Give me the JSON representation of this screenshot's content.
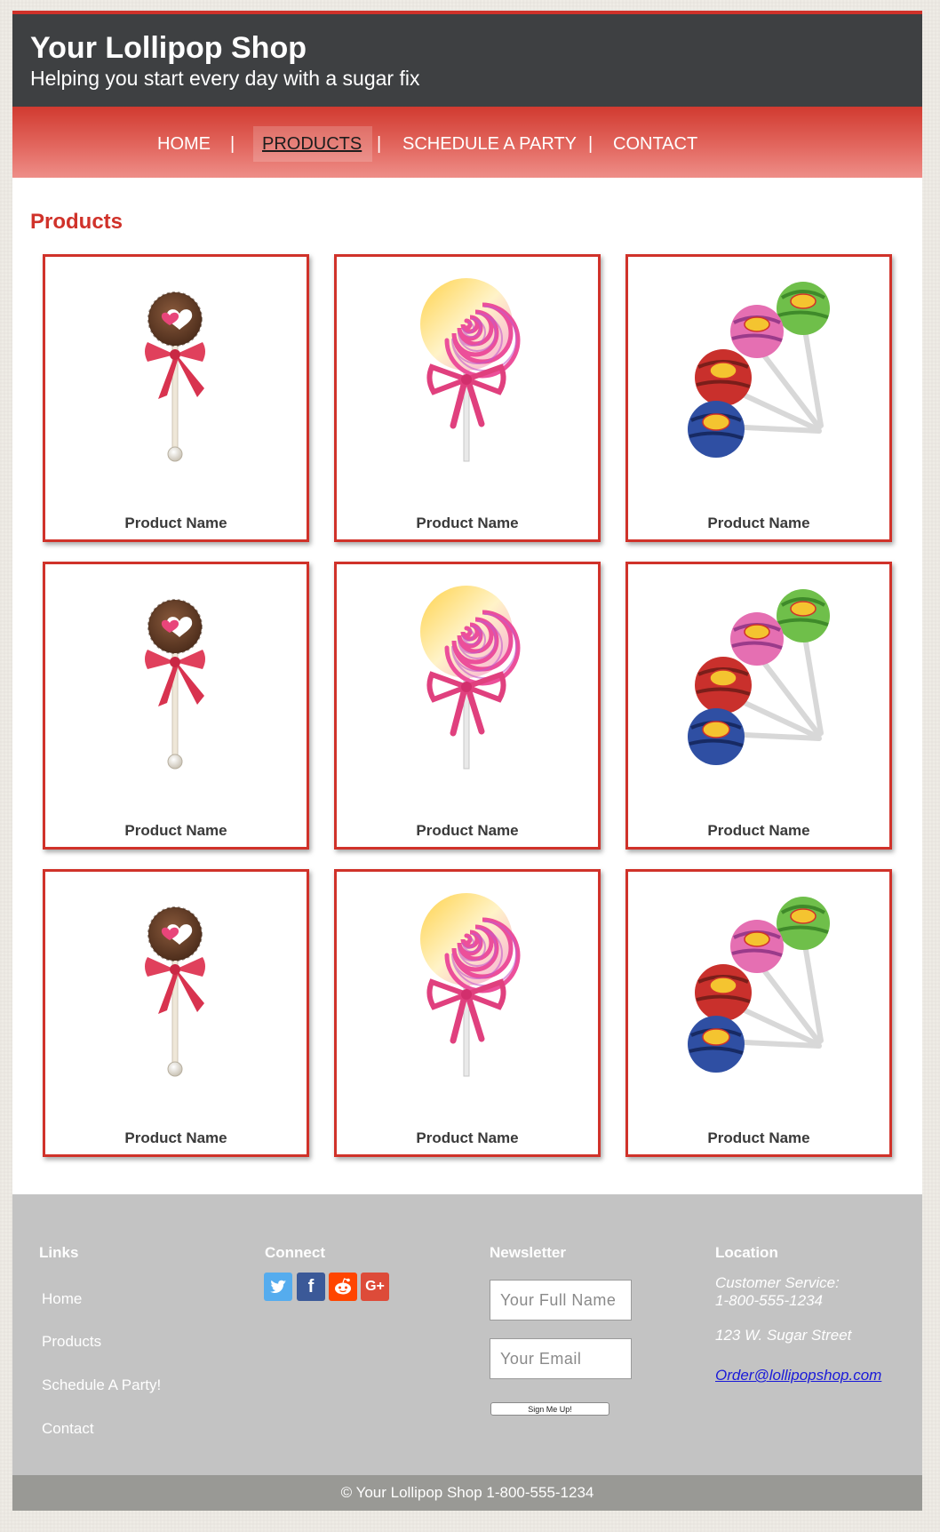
{
  "header": {
    "title": "Your Lollipop Shop",
    "tagline": "Helping you start every day with a sugar fix"
  },
  "nav": {
    "home": "HOME",
    "products": "PRODUCTS",
    "party": "SCHEDULE A PARTY",
    "contact": "CONTACT",
    "separator": "|",
    "active": "PRODUCTS"
  },
  "main": {
    "section_title": "Products",
    "products": [
      {
        "name": "Product Name",
        "image": "chocolate-heart-lollipop"
      },
      {
        "name": "Product Name",
        "image": "swirl-lollipop"
      },
      {
        "name": "Product Name",
        "image": "chupa-chups-bouquet"
      },
      {
        "name": "Product Name",
        "image": "chocolate-heart-lollipop"
      },
      {
        "name": "Product Name",
        "image": "swirl-lollipop"
      },
      {
        "name": "Product Name",
        "image": "chupa-chups-bouquet"
      },
      {
        "name": "Product Name",
        "image": "chocolate-heart-lollipop"
      },
      {
        "name": "Product Name",
        "image": "swirl-lollipop"
      },
      {
        "name": "Product Name",
        "image": "chupa-chups-bouquet"
      }
    ]
  },
  "footer": {
    "links": {
      "heading": "Links",
      "items": [
        "Home",
        "Products",
        "Schedule A Party!",
        "Contact"
      ]
    },
    "connect": {
      "heading": "Connect",
      "icons": [
        "twitter-icon",
        "facebook-icon",
        "reddit-icon",
        "google-plus-icon"
      ],
      "icon_labels": {
        "facebook": "f",
        "google_plus": "G+"
      }
    },
    "newsletter": {
      "heading": "Newsletter",
      "name_placeholder": "Your Full Name",
      "email_placeholder": "Your Email",
      "button": "Sign Me Up!"
    },
    "location": {
      "heading": "Location",
      "service_label": "Customer Service:",
      "phone": "1-800-555-1234",
      "address": "123 W. Sugar Street",
      "email": "Order@lollipopshop.com"
    },
    "copyright": "© Your Lollipop Shop 1-800-555-1234"
  },
  "colors": {
    "accent_red": "#d0322a",
    "header_dark": "#3e4042",
    "footer_gray": "#c3c3c3",
    "twitter": "#55acee",
    "facebook": "#3b5998",
    "reddit": "#ff4500",
    "google_plus": "#dd4b39"
  }
}
